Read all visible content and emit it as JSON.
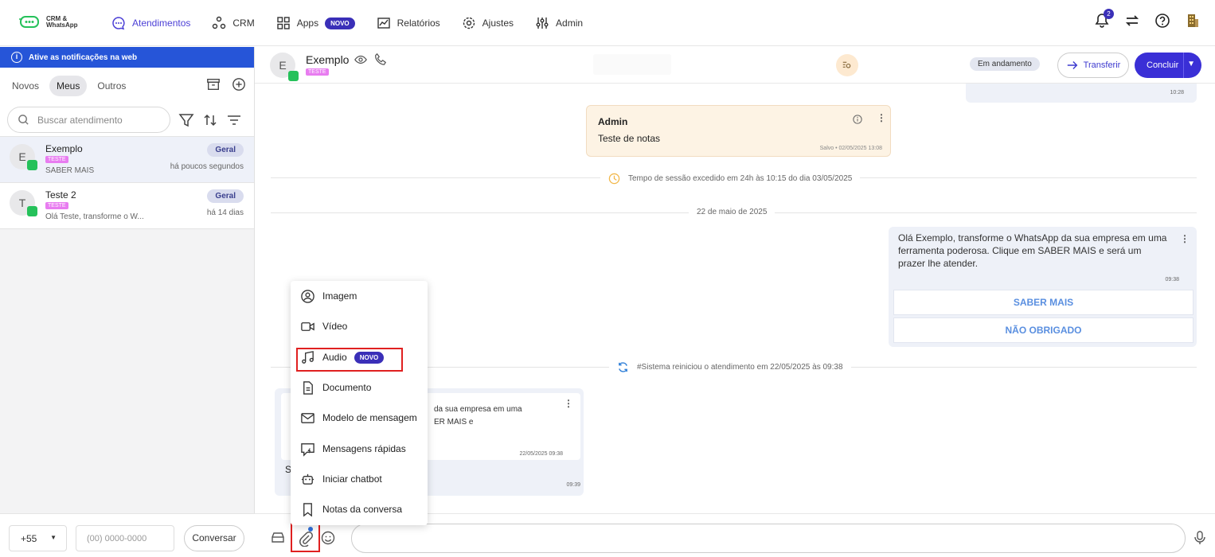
{
  "app": {
    "logo_text_1": "CRM &",
    "logo_text_2": "WhatsApp"
  },
  "nav": [
    {
      "label": "Atendimentos",
      "icon": "chat-icon",
      "active": true
    },
    {
      "label": "CRM",
      "icon": "crm-icon"
    },
    {
      "label": "Apps",
      "icon": "apps-icon",
      "badge": "NOVO"
    },
    {
      "label": "Relatórios",
      "icon": "chart-icon"
    },
    {
      "label": "Ajustes",
      "icon": "gear-icon"
    },
    {
      "label": "Admin",
      "icon": "sliders-icon"
    }
  ],
  "top_right": {
    "notifications_count": "2"
  },
  "sidebar": {
    "notif_text": "Ative as notificações na web",
    "tabs": [
      "Novos",
      "Meus",
      "Outros"
    ],
    "active_tab": "Meus",
    "search_placeholder": "Buscar atendimento",
    "conversations": [
      {
        "initial": "E",
        "name": "Exemplo",
        "tag": "TESTE",
        "message": "SABER MAIS",
        "badge": "Geral",
        "time": "há poucos segundos"
      },
      {
        "initial": "T",
        "name": "Teste 2",
        "tag": "TESTE",
        "message": "Olá Teste, transforme o W...",
        "badge": "Geral",
        "time": "há 14 dias"
      }
    ],
    "footer": {
      "ddi": "+55",
      "phone_placeholder": "(00) 0000-0000",
      "button": "Conversar"
    }
  },
  "chat_header": {
    "initial": "E",
    "name": "Exemplo",
    "tag": "TESTE",
    "status": "Em andamento",
    "transfer": "Transferir",
    "conclude": "Concluir"
  },
  "messages": {
    "top_out_time": "10:28",
    "note": {
      "author": "Admin",
      "text": "Teste de notas",
      "saved": "Salvo • 02/05/2025 13:08"
    },
    "session_expired": "Tempo de sessão excedido em 24h às 10:15 do dia 03/05/2025",
    "date_separator": "22 de maio de 2025",
    "outgoing": {
      "text": "Olá Exemplo, transforme o WhatsApp da sua empresa em uma ferramenta poderosa. Clique em SABER MAIS e será um prazer lhe atender.",
      "time": "09:38",
      "buttons": [
        "SABER MAIS",
        "NÃO OBRIGADO"
      ]
    },
    "system_restart": "#Sistema reiniciou o atendimento em 22/05/2025 às 09:38",
    "incoming": {
      "quoted_line1": "da sua empresa em uma",
      "quoted_line2": "ER MAIS e",
      "quoted_time": "22/05/2025 09:38",
      "text": "S",
      "time": "09:39"
    }
  },
  "attach_menu": [
    {
      "label": "Imagem",
      "icon": "image-icon"
    },
    {
      "label": "Vídeo",
      "icon": "video-icon"
    },
    {
      "label": "Audio",
      "icon": "music-icon",
      "badge": "NOVO"
    },
    {
      "label": "Documento",
      "icon": "document-icon"
    },
    {
      "label": "Modelo de mensagem",
      "icon": "mail-icon"
    },
    {
      "label": "Mensagens rápidas",
      "icon": "quick-message-icon"
    },
    {
      "label": "Iniciar chatbot",
      "icon": "robot-icon"
    },
    {
      "label": "Notas da conversa",
      "icon": "bookmark-icon"
    }
  ],
  "colors": {
    "accent": "#3a2fd6",
    "notif_bar": "#2655d8",
    "tag": "#e87cf0",
    "whatsapp": "#25c15a",
    "highlight": "#e02020"
  }
}
